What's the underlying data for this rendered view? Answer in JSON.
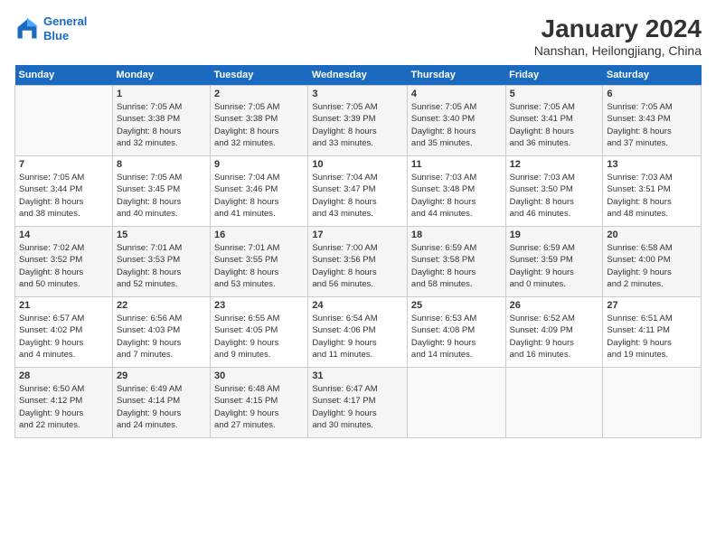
{
  "logo": {
    "line1": "General",
    "line2": "Blue"
  },
  "title": "January 2024",
  "subtitle": "Nanshan, Heilongjiang, China",
  "header_days": [
    "Sunday",
    "Monday",
    "Tuesday",
    "Wednesday",
    "Thursday",
    "Friday",
    "Saturday"
  ],
  "weeks": [
    {
      "days": [
        {
          "num": "",
          "info": ""
        },
        {
          "num": "1",
          "info": "Sunrise: 7:05 AM\nSunset: 3:38 PM\nDaylight: 8 hours\nand 32 minutes."
        },
        {
          "num": "2",
          "info": "Sunrise: 7:05 AM\nSunset: 3:38 PM\nDaylight: 8 hours\nand 32 minutes."
        },
        {
          "num": "3",
          "info": "Sunrise: 7:05 AM\nSunset: 3:39 PM\nDaylight: 8 hours\nand 33 minutes."
        },
        {
          "num": "4",
          "info": "Sunrise: 7:05 AM\nSunset: 3:40 PM\nDaylight: 8 hours\nand 35 minutes."
        },
        {
          "num": "5",
          "info": "Sunrise: 7:05 AM\nSunset: 3:41 PM\nDaylight: 8 hours\nand 36 minutes."
        },
        {
          "num": "6",
          "info": "Sunrise: 7:05 AM\nSunset: 3:43 PM\nDaylight: 8 hours\nand 37 minutes."
        }
      ]
    },
    {
      "days": [
        {
          "num": "7",
          "info": "Sunrise: 7:05 AM\nSunset: 3:44 PM\nDaylight: 8 hours\nand 38 minutes."
        },
        {
          "num": "8",
          "info": "Sunrise: 7:05 AM\nSunset: 3:45 PM\nDaylight: 8 hours\nand 40 minutes."
        },
        {
          "num": "9",
          "info": "Sunrise: 7:04 AM\nSunset: 3:46 PM\nDaylight: 8 hours\nand 41 minutes."
        },
        {
          "num": "10",
          "info": "Sunrise: 7:04 AM\nSunset: 3:47 PM\nDaylight: 8 hours\nand 43 minutes."
        },
        {
          "num": "11",
          "info": "Sunrise: 7:03 AM\nSunset: 3:48 PM\nDaylight: 8 hours\nand 44 minutes."
        },
        {
          "num": "12",
          "info": "Sunrise: 7:03 AM\nSunset: 3:50 PM\nDaylight: 8 hours\nand 46 minutes."
        },
        {
          "num": "13",
          "info": "Sunrise: 7:03 AM\nSunset: 3:51 PM\nDaylight: 8 hours\nand 48 minutes."
        }
      ]
    },
    {
      "days": [
        {
          "num": "14",
          "info": "Sunrise: 7:02 AM\nSunset: 3:52 PM\nDaylight: 8 hours\nand 50 minutes."
        },
        {
          "num": "15",
          "info": "Sunrise: 7:01 AM\nSunset: 3:53 PM\nDaylight: 8 hours\nand 52 minutes."
        },
        {
          "num": "16",
          "info": "Sunrise: 7:01 AM\nSunset: 3:55 PM\nDaylight: 8 hours\nand 53 minutes."
        },
        {
          "num": "17",
          "info": "Sunrise: 7:00 AM\nSunset: 3:56 PM\nDaylight: 8 hours\nand 56 minutes."
        },
        {
          "num": "18",
          "info": "Sunrise: 6:59 AM\nSunset: 3:58 PM\nDaylight: 8 hours\nand 58 minutes."
        },
        {
          "num": "19",
          "info": "Sunrise: 6:59 AM\nSunset: 3:59 PM\nDaylight: 9 hours\nand 0 minutes."
        },
        {
          "num": "20",
          "info": "Sunrise: 6:58 AM\nSunset: 4:00 PM\nDaylight: 9 hours\nand 2 minutes."
        }
      ]
    },
    {
      "days": [
        {
          "num": "21",
          "info": "Sunrise: 6:57 AM\nSunset: 4:02 PM\nDaylight: 9 hours\nand 4 minutes."
        },
        {
          "num": "22",
          "info": "Sunrise: 6:56 AM\nSunset: 4:03 PM\nDaylight: 9 hours\nand 7 minutes."
        },
        {
          "num": "23",
          "info": "Sunrise: 6:55 AM\nSunset: 4:05 PM\nDaylight: 9 hours\nand 9 minutes."
        },
        {
          "num": "24",
          "info": "Sunrise: 6:54 AM\nSunset: 4:06 PM\nDaylight: 9 hours\nand 11 minutes."
        },
        {
          "num": "25",
          "info": "Sunrise: 6:53 AM\nSunset: 4:08 PM\nDaylight: 9 hours\nand 14 minutes."
        },
        {
          "num": "26",
          "info": "Sunrise: 6:52 AM\nSunset: 4:09 PM\nDaylight: 9 hours\nand 16 minutes."
        },
        {
          "num": "27",
          "info": "Sunrise: 6:51 AM\nSunset: 4:11 PM\nDaylight: 9 hours\nand 19 minutes."
        }
      ]
    },
    {
      "days": [
        {
          "num": "28",
          "info": "Sunrise: 6:50 AM\nSunset: 4:12 PM\nDaylight: 9 hours\nand 22 minutes."
        },
        {
          "num": "29",
          "info": "Sunrise: 6:49 AM\nSunset: 4:14 PM\nDaylight: 9 hours\nand 24 minutes."
        },
        {
          "num": "30",
          "info": "Sunrise: 6:48 AM\nSunset: 4:15 PM\nDaylight: 9 hours\nand 27 minutes."
        },
        {
          "num": "31",
          "info": "Sunrise: 6:47 AM\nSunset: 4:17 PM\nDaylight: 9 hours\nand 30 minutes."
        },
        {
          "num": "",
          "info": ""
        },
        {
          "num": "",
          "info": ""
        },
        {
          "num": "",
          "info": ""
        }
      ]
    }
  ]
}
